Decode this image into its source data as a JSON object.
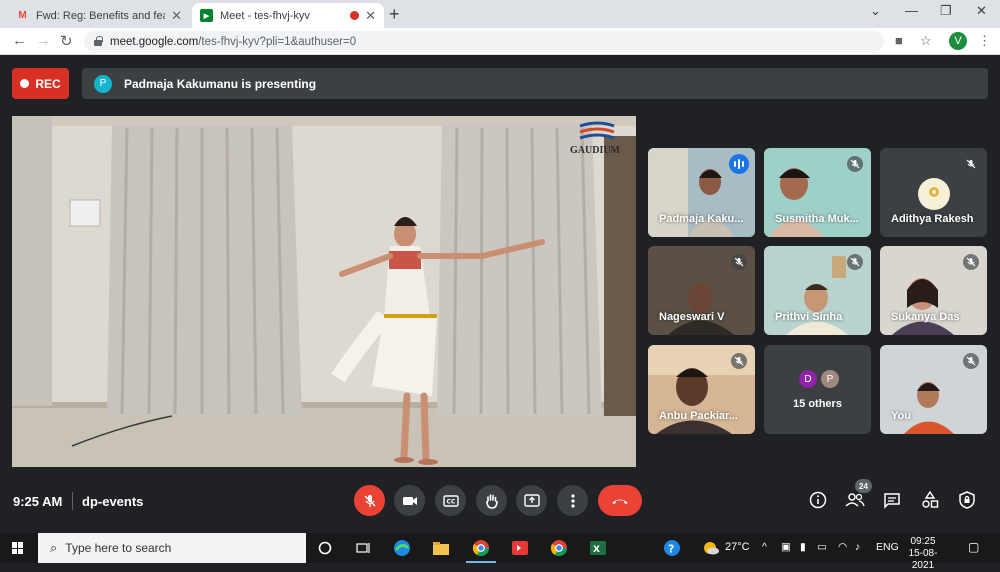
{
  "browser": {
    "tabs": [
      {
        "title": "Fwd: Reg: Benefits and feautres.",
        "favicon": "gmail-icon"
      },
      {
        "title": "Meet - tes-fhvj-kyv",
        "favicon": "meet-icon",
        "recording": true
      }
    ],
    "url_host": "meet.google.com",
    "url_path": "/tes-fhvj-kyv?pli=1&authuser=0",
    "profile_initial": "V"
  },
  "meet": {
    "rec_label": "REC",
    "presenter_initial": "P",
    "presenting_text": "Padmaja Kakumanu is presenting",
    "watermark": "GAUDIUM SCHOOL",
    "participants": [
      {
        "name": "Padmaja Kaku...",
        "speaking": true
      },
      {
        "name": "Susmitha Muk...",
        "muted": true
      },
      {
        "name": "Adithya Rakesh",
        "muted": true,
        "avatar_text": "Adithya Rakesh"
      },
      {
        "name": "Nageswari V",
        "muted": true
      },
      {
        "name": "Prithvi Sinha",
        "muted": true
      },
      {
        "name": "Sukanya Das",
        "muted": true
      },
      {
        "name": "Anbu Packiar...",
        "muted": true
      },
      {
        "name": "15 others",
        "avatars": [
          "D",
          "P"
        ]
      },
      {
        "name": "You",
        "muted": true
      }
    ],
    "time": "9:25 AM",
    "meeting_code": "dp-events",
    "people_count": "24"
  },
  "taskbar": {
    "search_placeholder": "Type here to search",
    "weather": "27°C",
    "language": "ENG",
    "clock_time": "09:25",
    "clock_date": "15-08-2021"
  },
  "colors": {
    "meet_bg": "#202124",
    "rec_red": "#d93025",
    "hangup_red": "#ea4335",
    "tile_bg": "#3c4043",
    "active_outline": "#8ab4f8"
  }
}
